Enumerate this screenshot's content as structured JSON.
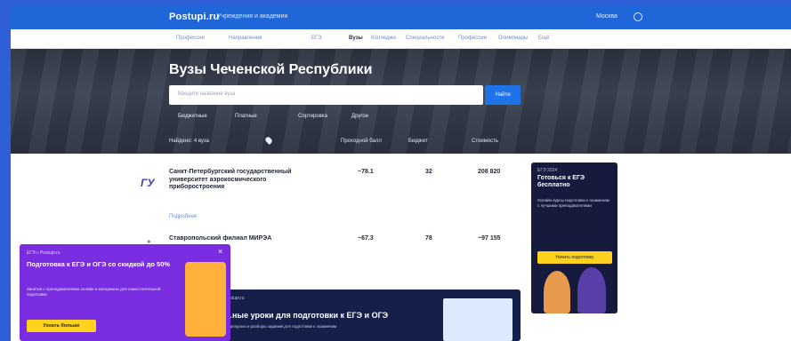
{
  "topbar": {
    "logo": "Postupi.ru",
    "section": "Учреждения и академии",
    "region": "Москва"
  },
  "tabs": [
    "Профессии",
    "Направления",
    "ЕГЭ",
    "Вузы",
    "Колледжи",
    "Специальности",
    "Профессии",
    "Олимпиады",
    "Ещё"
  ],
  "hero": {
    "title": "Вузы Чеченской Республики",
    "search_placeholder": "Введите название вуза",
    "search_button": "Найти",
    "chips": [
      "Бюджетные",
      "Платные",
      "Сортировка",
      "Другое"
    ],
    "found_label": "Найдено: 4 вуза",
    "sort_labels": [
      "Проходной балл",
      "Бюджет",
      "Стоимость"
    ]
  },
  "universities": [
    {
      "name": "Санкт-Петербургский государственный университет аэрокосмического приборостроения",
      "more": "Подробнее",
      "score": "78.1",
      "budget": "32",
      "price": "208 820"
    },
    {
      "name": "Ставропольский филиал МИРЭА",
      "more": "",
      "score": "67.3",
      "budget": "78",
      "price": "97 155"
    }
  ],
  "side_ad": {
    "tag": "ЕГЭ 2024",
    "title": "Готовься к ЕГЭ бесплатно",
    "text": "Онлайн-курсы подготовки к экзаменам с лучшими преподавателями",
    "button": "Начать подготовку"
  },
  "bottom_ad": {
    "tag": "Postupi.ru",
    "title": "…ные уроки для подготовки к ЕГЭ и ОГЭ",
    "text": "Видеоуроки и разборы заданий для подготовки к экзаменам"
  },
  "popup": {
    "tag": "ЕГЭ с Postupi.ru",
    "title": "Подготовка к ЕГЭ и ОГЭ со скидкой до 50%",
    "text": "Занятия с преподавателями онлайн и материалы для самостоятельной подготовки",
    "button": "Узнать больше",
    "close": "×"
  }
}
